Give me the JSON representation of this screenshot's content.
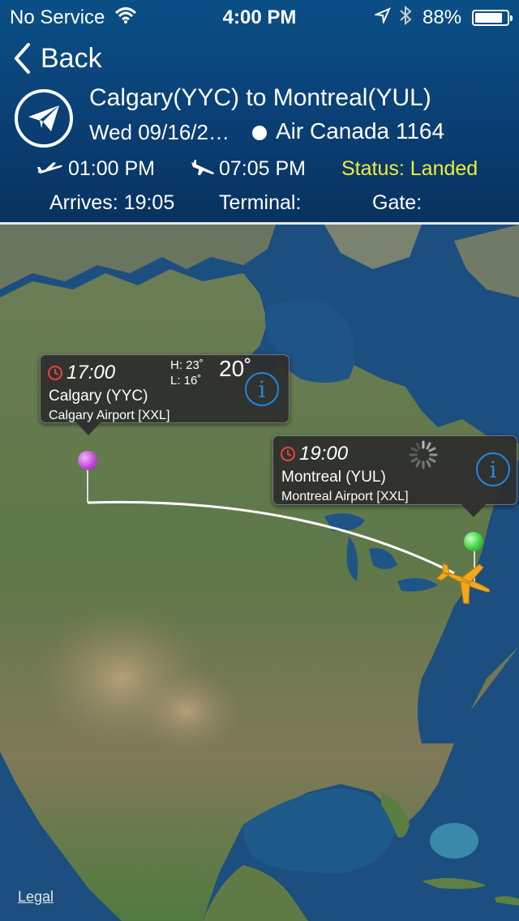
{
  "status_bar": {
    "carrier": "No Service",
    "time": "4:00 PM",
    "battery": "88%",
    "battery_level": 0.88
  },
  "nav": {
    "back_label": "Back"
  },
  "flight": {
    "route": "Calgary(YYC) to Montreal(YUL)",
    "date": "Wed 09/16/2…",
    "airline": "Air Canada 1164",
    "departure_time": "01:00 PM",
    "arrival_time": "07:05 PM",
    "status": "Status: Landed",
    "arrives": "Arrives: 19:05",
    "terminal": "Terminal:",
    "gate": "Gate:"
  },
  "map": {
    "origin": {
      "time": "17:00",
      "city": "Calgary (YYC)",
      "airport": "Calgary Airport [XXL]",
      "high": "H: 23˚",
      "low": "L: 16˚",
      "temp": "20˚",
      "pin_color": "#c04ad6"
    },
    "destination": {
      "time": "19:00",
      "city": "Montreal (YUL)",
      "airport": "Montreal Airport [XXL]",
      "pin_color": "#3dcf3d"
    },
    "legal": "Legal"
  },
  "colors": {
    "status_accent": "#f0ec3a",
    "info_accent": "#1e88e5",
    "header_bg": "#0a4577"
  },
  "icons": [
    "wifi-icon",
    "location-arrow-icon",
    "bluetooth-icon",
    "battery-icon",
    "chevron-left-icon",
    "paper-plane-icon",
    "takeoff-icon",
    "landing-icon",
    "clock-icon",
    "info-icon",
    "loading-spinner-icon",
    "airplane-icon"
  ]
}
